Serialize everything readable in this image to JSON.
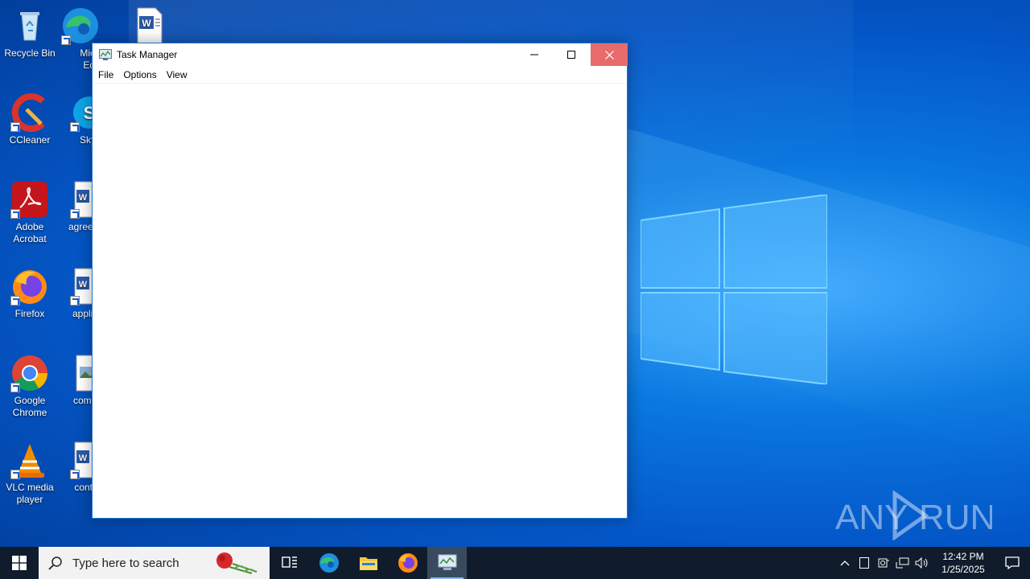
{
  "desktop": {
    "icons": [
      {
        "label": "Recycle Bin"
      },
      {
        "label": "Micro Edg"
      },
      {
        "label": ""
      },
      {
        "label": "CCleaner"
      },
      {
        "label": "Sky"
      },
      {
        "label": "Adobe Acrobat"
      },
      {
        "label": "agreem"
      },
      {
        "label": "Firefox"
      },
      {
        "label": "applica"
      },
      {
        "label": "Google Chrome"
      },
      {
        "label": "compa"
      },
      {
        "label": "VLC media player"
      },
      {
        "label": "contra"
      }
    ]
  },
  "window": {
    "title": "Task Manager",
    "menu": [
      "File",
      "Options",
      "View"
    ]
  },
  "watermark": {
    "text": "ANY RUN"
  },
  "taskbar": {
    "search_placeholder": "Type here to search",
    "apps": [
      "task-view",
      "edge",
      "file-explorer",
      "firefox",
      "task-manager"
    ],
    "clock_time": "12:42 PM",
    "clock_date": "1/25/2025"
  },
  "colors": {
    "close_button": "#e86a6a",
    "taskbar": "#101c2c",
    "window_border": "#1976d2"
  }
}
